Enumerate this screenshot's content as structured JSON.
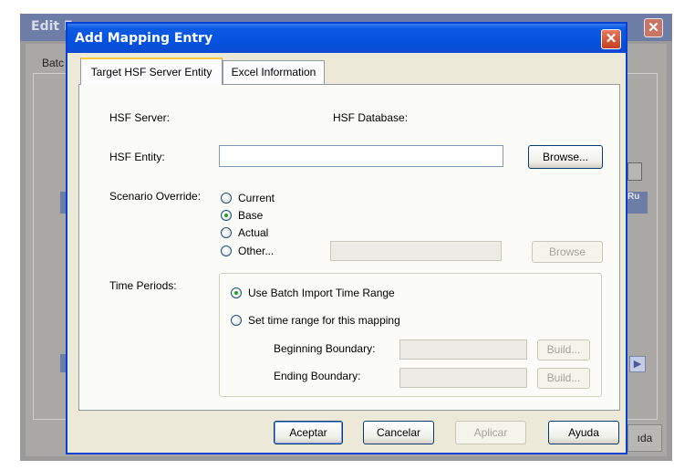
{
  "background_window": {
    "title": "Edit E",
    "close_glyph": "✕",
    "tab_label": "Batc",
    "column_header_right": "Ru",
    "scroll_right_glyph": "▶",
    "button_label": "ıda"
  },
  "dialog": {
    "title": "Add Mapping Entry",
    "close_glyph": "✕",
    "tabs": [
      {
        "label": "Target HSF Server Entity",
        "active": true
      },
      {
        "label": "Excel Information",
        "active": false
      }
    ],
    "hsf_server_label": "HSF Server:",
    "hsf_database_label": "HSF Database:",
    "hsf_entity_label": "HSF Entity:",
    "hsf_entity_value": "",
    "browse_label": "Browse...",
    "scenario_label": "Scenario Override:",
    "scenario_options": [
      {
        "label": "Current",
        "selected": false
      },
      {
        "label": "Base",
        "selected": true
      },
      {
        "label": "Actual",
        "selected": false
      },
      {
        "label": "Other...",
        "selected": false
      }
    ],
    "other_value": "",
    "other_browse_label": "Browse",
    "time_periods_label": "Time Periods:",
    "time_options": [
      {
        "label": "Use Batch Import Time Range",
        "selected": true
      },
      {
        "label": "Set time range for this mapping",
        "selected": false
      }
    ],
    "beginning_label": "Beginning Boundary:",
    "ending_label": "Ending Boundary:",
    "build_label": "Build...",
    "buttons": {
      "ok": "Aceptar",
      "cancel": "Cancelar",
      "apply": "Aplicar",
      "help": "Ayuda"
    }
  },
  "colors": {
    "title_bar": "#0552e0",
    "dialog_face": "#ece9d8",
    "radio_dot": "#21a121",
    "close_button": "#c4401e"
  }
}
